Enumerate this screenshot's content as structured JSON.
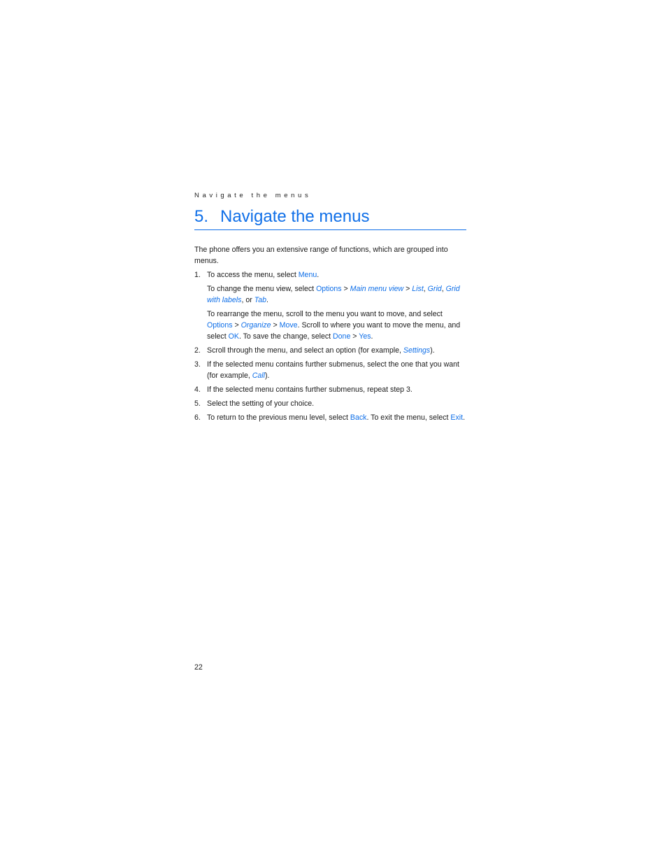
{
  "running_head": "Navigate the menus",
  "chapter": {
    "number": "5.",
    "title": "Navigate the menus"
  },
  "intro": "The phone offers you an extensive range of functions, which are grouped into menus.",
  "steps": [
    {
      "marker": "1.",
      "text": {
        "t1": "To access the menu, select ",
        "cmd1": "Menu",
        "t2": "."
      },
      "sub1": {
        "t1": "To change the menu view, select ",
        "cmd1": "Options",
        "sep1": " > ",
        "opt1": "Main menu view",
        "sep2": " > ",
        "opt2": "List",
        "sep3": ", ",
        "opt3": "Grid",
        "sep4": ", ",
        "opt4": "Grid with labels",
        "sep5": ", or ",
        "opt5": "Tab",
        "t2": "."
      },
      "sub2": {
        "t1": "To rearrange the menu, scroll to the menu you want to move, and select ",
        "cmd1": "Options",
        "sep1": " > ",
        "opt1": "Organize",
        "sep2": " > ",
        "cmd2": "Move",
        "t2": ". Scroll to where you want to move the menu, and select ",
        "cmd3": "OK",
        "t3": ". To save the change, select ",
        "cmd4": "Done",
        "sep3": " > ",
        "cmd5": "Yes",
        "t4": "."
      }
    },
    {
      "marker": "2.",
      "text": {
        "t1": "Scroll through the menu, and select an option (for example, ",
        "opt1": "Settings",
        "t2": ")."
      }
    },
    {
      "marker": "3.",
      "text": {
        "t1": "If the selected menu contains further submenus, select the one that you want (for example, ",
        "opt1": "Call",
        "t2": ")."
      }
    },
    {
      "marker": "4.",
      "text": "If the selected menu contains further submenus, repeat step 3."
    },
    {
      "marker": "5.",
      "text": "Select the setting of your choice."
    },
    {
      "marker": "6.",
      "text": {
        "t1": "To return to the previous menu level, select ",
        "cmd1": "Back",
        "t2": ". To exit the menu, select ",
        "cmd2": "Exit",
        "t3": "."
      }
    }
  ],
  "page_number": "22",
  "colors": {
    "accent": "#0f6fe8",
    "body_text": "#1a1a1a"
  }
}
